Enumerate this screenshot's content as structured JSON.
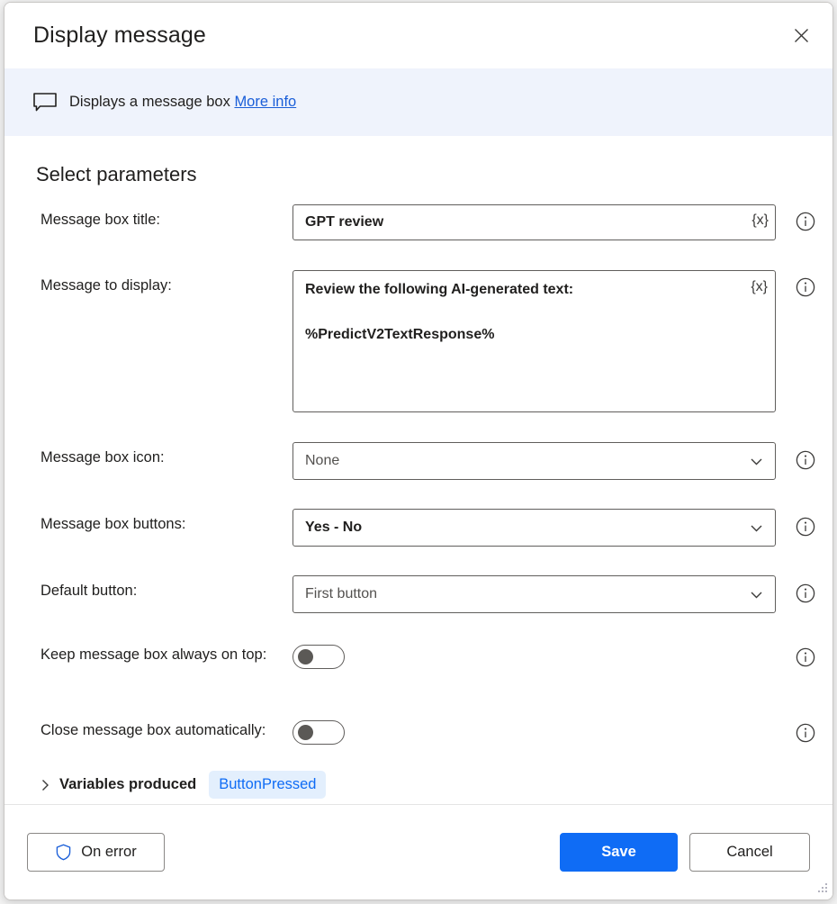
{
  "dialog": {
    "title": "Display message",
    "close_label": "×"
  },
  "banner": {
    "icon": "message-box-icon",
    "text": "Displays a message box",
    "link": "More info"
  },
  "section": {
    "heading": "Select parameters"
  },
  "fields": {
    "message_box_title": {
      "label": "Message box title:",
      "value": "GPT review",
      "variable_button": "{x}",
      "info": "i"
    },
    "message_to_display": {
      "label": "Message to display:",
      "value": "Review the following AI-generated text:\n\n%PredictV2TextResponse%",
      "variable_button": "{x}",
      "info": "i"
    },
    "message_box_icon": {
      "label": "Message box icon:",
      "value": "None",
      "info": "i"
    },
    "message_box_buttons": {
      "label": "Message box buttons:",
      "value": "Yes - No",
      "info": "i"
    },
    "default_button": {
      "label": "Default button:",
      "value": "First button",
      "info": "i"
    },
    "keep_on_top": {
      "label": "Keep message box always on top:",
      "state": "off",
      "info": "i"
    },
    "close_automatically": {
      "label": "Close message box automatically:",
      "state": "off",
      "info": "i"
    }
  },
  "variables_produced": {
    "title": "Variables produced",
    "expanded": false,
    "items": [
      {
        "name": "ButtonPressed"
      }
    ]
  },
  "footer": {
    "on_error_label": "On error",
    "save_label": "Save",
    "cancel_label": "Cancel"
  },
  "colors": {
    "accent": "#0f6cf5",
    "link": "#1a5ed8",
    "banner_bg": "#eff3fc",
    "pill_bg": "#e3effd",
    "border": "#605e5c"
  }
}
